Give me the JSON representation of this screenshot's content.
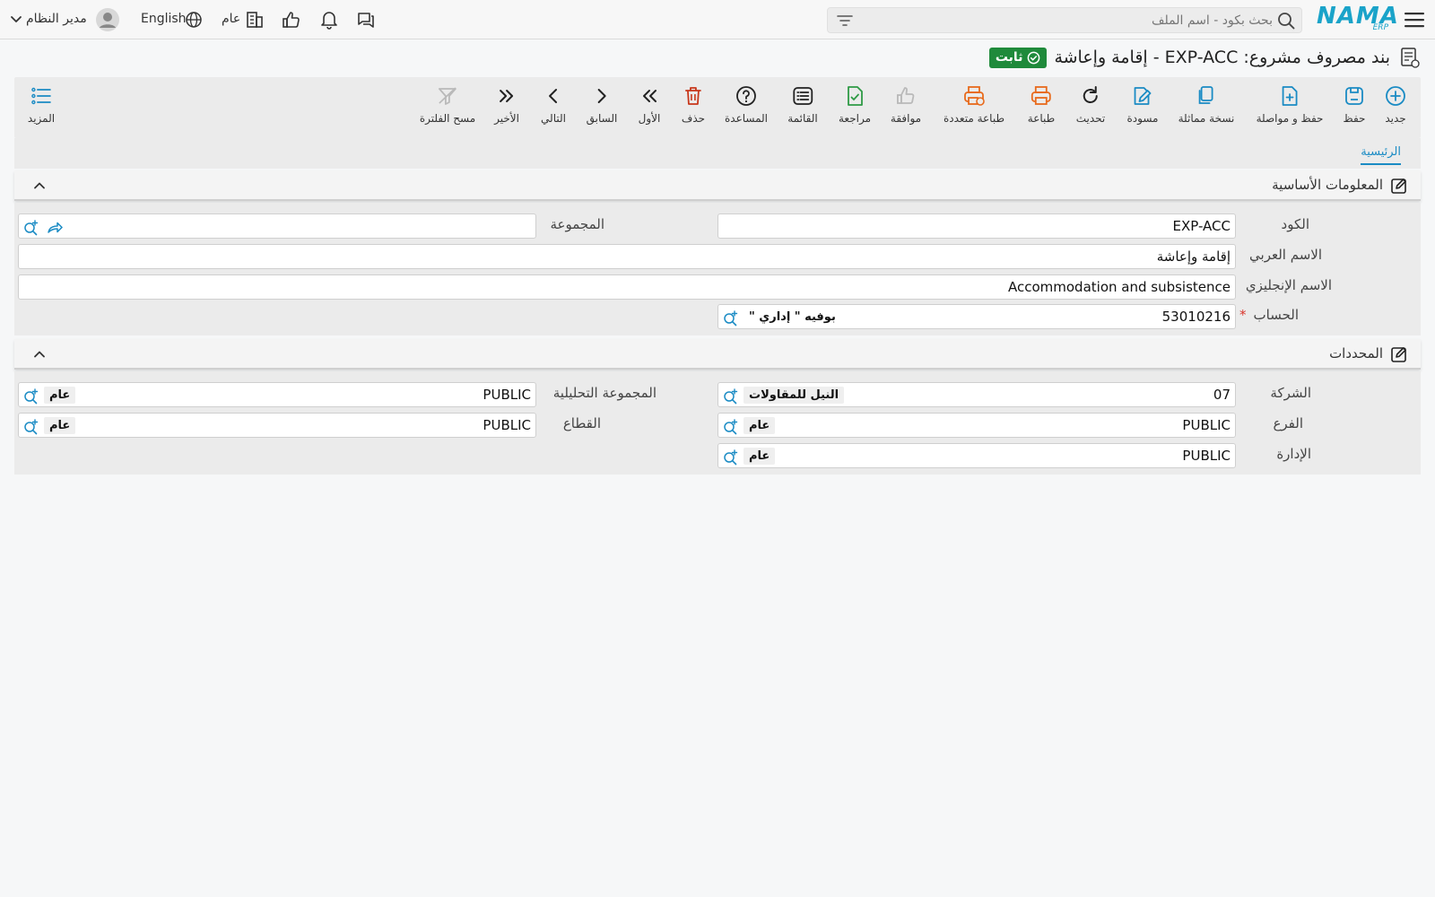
{
  "topbar": {
    "logo_text": "NAMA",
    "logo_sub": "ERP",
    "search_placeholder": "بحث بكود - اسم الملف",
    "company_label": "عام",
    "language_label": "English",
    "user_name": "مدير النظام"
  },
  "page": {
    "title": "بند مصروف مشروع: EXP-ACC - إقامة وإعاشة",
    "status": "ثابت"
  },
  "toolbar": {
    "new": "جديد",
    "save": "حفظ",
    "save_continue": "حفظ و مواصلة",
    "duplicate": "نسخة مماثلة",
    "draft": "مسودة",
    "refresh": "تحديث",
    "print": "طباعة",
    "multi_print": "طباعة متعددة",
    "approve": "موافقة",
    "review": "مراجعة",
    "list": "القائمة",
    "help": "المساعدة",
    "delete": "حذف",
    "first": "الأول",
    "previous": "السابق",
    "next": "التالي",
    "last": "الأخير",
    "clear_filter": "مسح الفلترة",
    "more": "المزيد"
  },
  "tabs": {
    "main": "الرئيسية"
  },
  "basic_info": {
    "title": "المعلومات الأساسية",
    "code_label": "الكود",
    "code_value": "EXP-ACC",
    "group_label": "المجموعة",
    "group_value": "",
    "arabic_name_label": "الاسم العربي",
    "arabic_name_value": "إقامة وإعاشة",
    "english_name_label": "الاسم الإنجليزي",
    "english_name_value": "Accommodation and subsistence",
    "account_label": "الحساب",
    "required_mark": "*",
    "account_code": "53010216",
    "account_name": "بوفيه \" إداري \""
  },
  "dimensions": {
    "title": "المحددات",
    "company_label": "الشركة",
    "company_code": "07",
    "company_name": "النيل للمقاولات",
    "analytic_group_label": "المجموعة التحليلية",
    "analytic_group_code": "PUBLIC",
    "analytic_group_name": "عام",
    "branch_label": "الفرع",
    "branch_code": "PUBLIC",
    "branch_name": "عام",
    "sector_label": "القطاع",
    "sector_code": "PUBLIC",
    "sector_name": "عام",
    "department_label": "الإدارة",
    "department_code": "PUBLIC",
    "department_name": "عام"
  },
  "colors": {
    "accent": "#1a8bc4",
    "success": "#1f8a3b",
    "danger": "#d9342b",
    "print_orange": "#e86a1c",
    "review_green": "#2e9a45"
  }
}
